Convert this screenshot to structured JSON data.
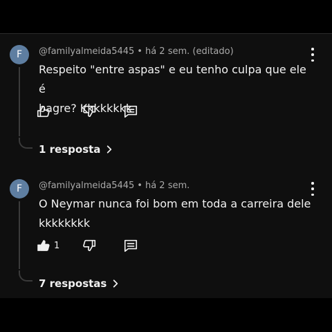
{
  "comments": [
    {
      "avatar_letter": "F",
      "author": "@familyalmeida5445",
      "separator": "•",
      "time": "há 2 sem.",
      "edited": "(editado)",
      "text_line1": "Respeito \"entre aspas\" e eu tenho culpa que ele é",
      "text_line2": "bagre? Kkkkkkkk",
      "likes": "",
      "like_filled": false,
      "replies_label": "1 resposta"
    },
    {
      "avatar_letter": "F",
      "author": "@familyalmeida5445",
      "separator": "•",
      "time": "há 2 sem.",
      "edited": "",
      "text_line1": "O Neymar nunca foi bom em toda a carreira dele",
      "text_line2": "kkkkkkkk",
      "likes": "1",
      "like_filled": true,
      "replies_label": "7 respostas"
    }
  ],
  "icons": {
    "like": "thumbs-up-icon",
    "dislike": "thumbs-down-icon",
    "reply": "reply-icon",
    "menu": "more-vert-icon",
    "chevron": "chevron-right-icon"
  }
}
